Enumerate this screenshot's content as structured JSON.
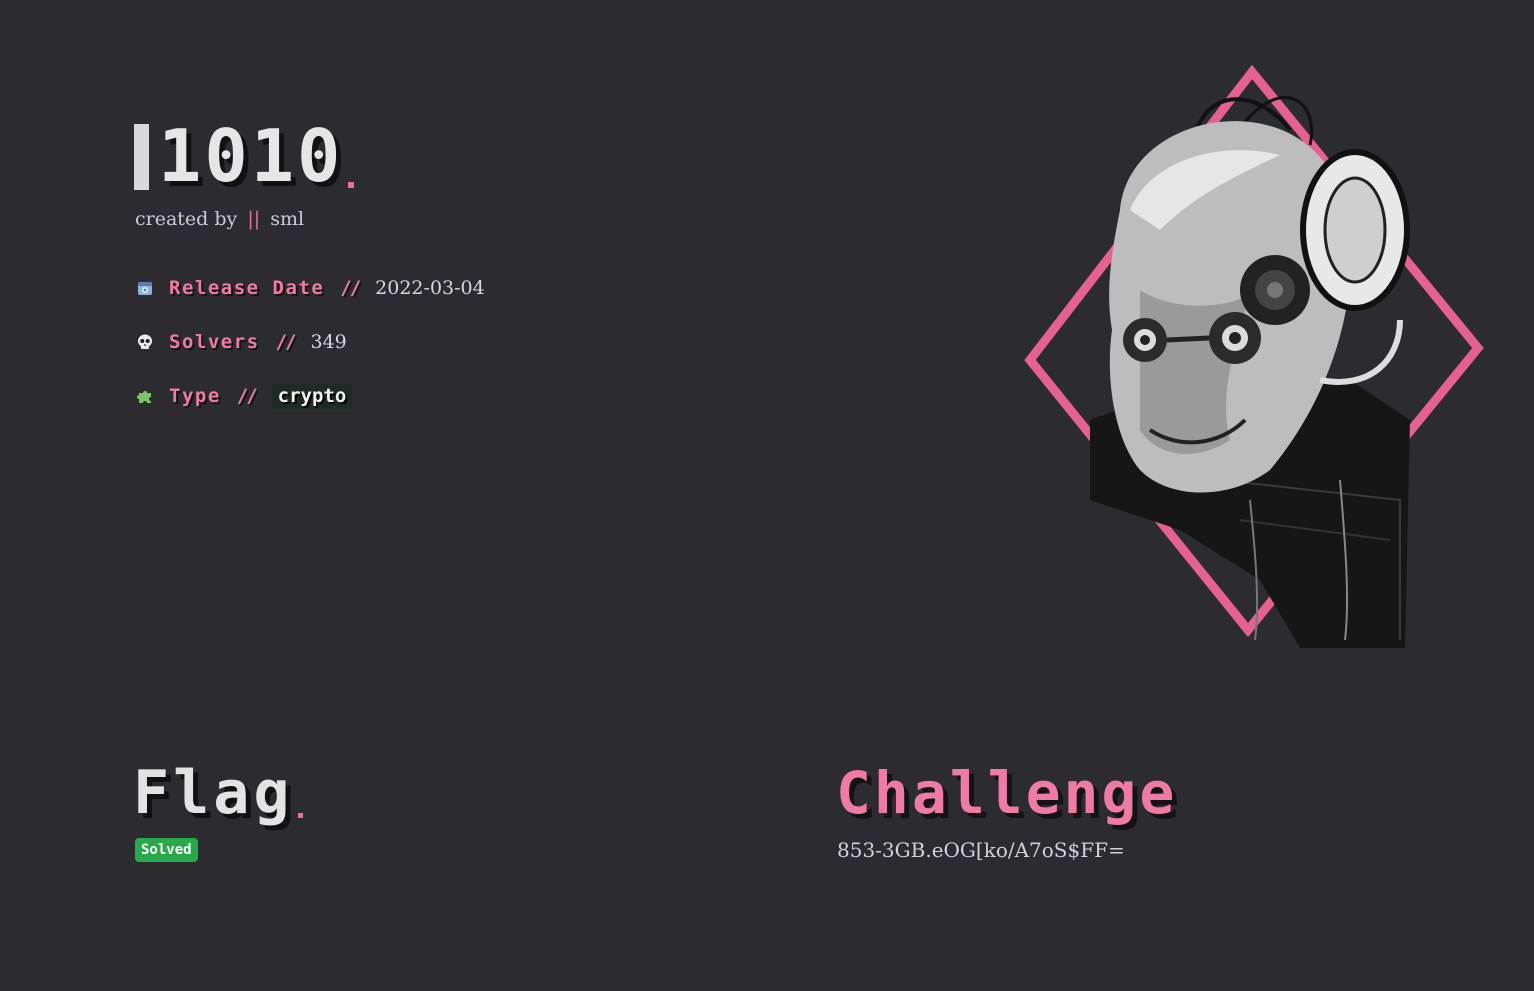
{
  "challenge": {
    "title": "1010",
    "created_by_prefix": "created by",
    "created_by_separator": "||",
    "author": "sml",
    "release_date_label": "Release Date",
    "release_date_separator": "//",
    "release_date": "2022-03-04",
    "solvers_label": "Solvers",
    "solvers_separator": "//",
    "solvers": "349",
    "type_label": "Type",
    "type_separator": "//",
    "type": "crypto"
  },
  "flag_section": {
    "heading": "Flag",
    "status": "Solved"
  },
  "challenge_section": {
    "heading": "Challenge",
    "ciphertext": "853-3GB.eOG[ko/A7oS$FF="
  },
  "icons": {
    "release_date": "calendar-icon",
    "solvers": "skull-icon",
    "type": "puzzle-icon",
    "portrait": "cyborg-portrait"
  },
  "colors": {
    "background": "#2c2b30",
    "accent_pink": "#f07aa6",
    "solved_green": "#27a84a",
    "text": "#d6d3d8"
  }
}
